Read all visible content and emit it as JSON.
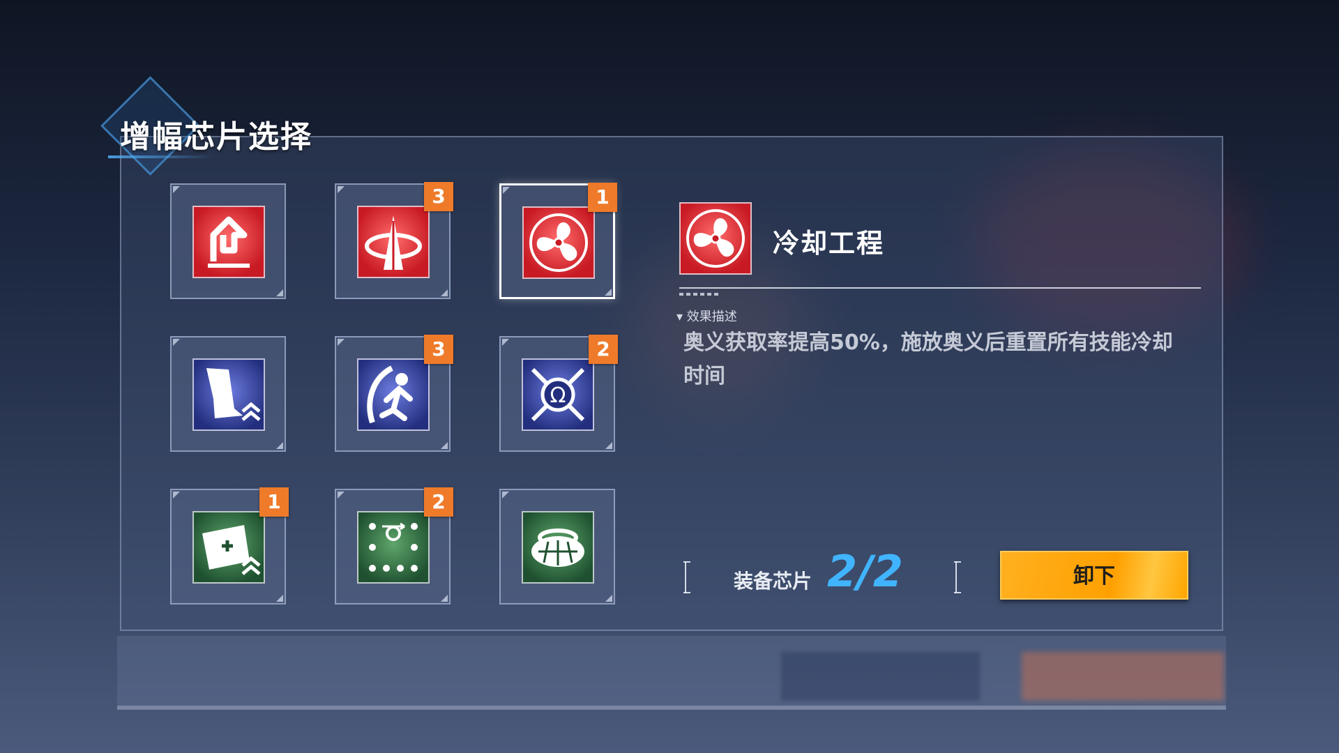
{
  "title": "增幅芯片选择",
  "chips": [
    {
      "name": "arrow-up-chip-icon",
      "color": "red",
      "badge": ""
    },
    {
      "name": "tower-chip-icon",
      "color": "red",
      "badge": "3"
    },
    {
      "name": "fan-chip-icon",
      "color": "red",
      "badge": "1",
      "selected": true
    },
    {
      "name": "foot-speed-chip-icon",
      "color": "blue",
      "badge": ""
    },
    {
      "name": "runner-chip-icon",
      "color": "blue",
      "badge": "3"
    },
    {
      "name": "swords-shield-chip-icon",
      "color": "blue",
      "badge": "2"
    },
    {
      "name": "medkit-chip-icon",
      "color": "green",
      "badge": "1"
    },
    {
      "name": "grid-dots-chip-icon",
      "color": "green",
      "badge": "2"
    },
    {
      "name": "shell-chip-icon",
      "color": "green",
      "badge": ""
    }
  ],
  "detail": {
    "name": "冷却工程",
    "section_label": "▾ 效果描述",
    "description": "奥义获取率提高50%，施放奥义后重置所有技能冷却时间"
  },
  "equip": {
    "label": "装备芯片",
    "count": "2/2"
  },
  "unload_button": "卸下",
  "colors": {
    "badge": "#ee7a2a",
    "accent_blue": "#41b4ff",
    "button": "#ffa000"
  }
}
